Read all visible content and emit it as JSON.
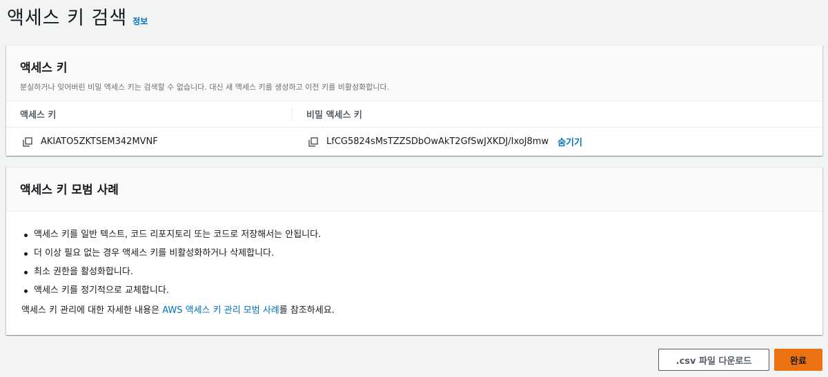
{
  "page": {
    "title": "액세스 키 검색",
    "info_link": "정보"
  },
  "access_key_card": {
    "title": "액세스 키",
    "description": "분실하거나 잊어버린 비밀 액세스 키는 검색할 수 없습니다. 대신 새 액세스 키를 생성하고 이전 키를 비활성화합니다.",
    "columns": [
      "액세스 키",
      "비밀 액세스 키"
    ],
    "access_key_id": "AKIATO5ZKTSEM342MVNF",
    "secret_access_key": "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",
    "hide_label": "숨기기",
    "copy_icon": "copy-icon"
  },
  "best_practices_card": {
    "title": "액세스 키 모범 사례",
    "items": [
      "액세스 키를 일반 텍스트, 코드 리포지토리 또는 코드로 저장해서는 안됩니다.",
      "더 이상 필요 없는 경우 액세스 키를 비활성화하거나 삭제합니다.",
      "최소 권한을 활성화합니다.",
      "액세스 키를 정기적으로 교체합니다."
    ],
    "more_info_prefix": "액세스 키 관리에 대한 자세한 내용은 ",
    "more_info_link": "AWS 액세스 키 관리 모범 사례",
    "more_info_suffix": "를 참조하세요."
  },
  "actions": {
    "download_csv": ".csv 파일 다운로드",
    "done": "완료"
  },
  "colors": {
    "link": "#0073bb",
    "primary_button": "#ec7211",
    "background": "#f2f3f3"
  }
}
